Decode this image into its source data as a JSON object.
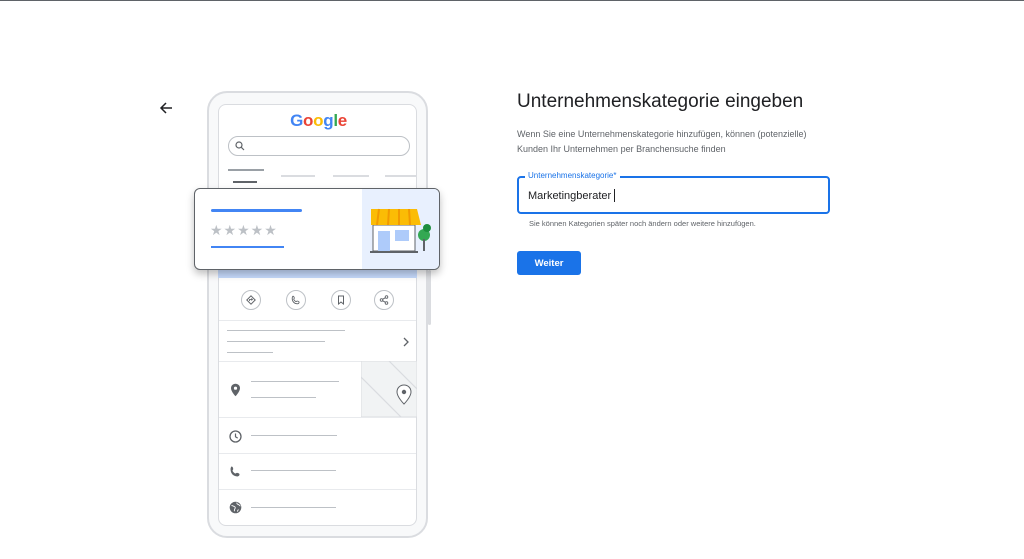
{
  "back_icon": "arrow-back-icon",
  "illustration": {
    "logo_letters": [
      {
        "ch": "G",
        "color": "#4285f4"
      },
      {
        "ch": "o",
        "color": "#ea4335"
      },
      {
        "ch": "o",
        "color": "#fbbc05"
      },
      {
        "ch": "g",
        "color": "#4285f4"
      },
      {
        "ch": "l",
        "color": "#34a853"
      },
      {
        "ch": "e",
        "color": "#ea4335"
      }
    ],
    "stars": "★★★★★",
    "action_icons": [
      "directions-icon",
      "phone-icon",
      "bookmark-icon",
      "share-icon"
    ],
    "row_icons": [
      "location-pin-icon",
      "clock-icon",
      "phone-icon",
      "globe-icon"
    ]
  },
  "form": {
    "title": "Unternehmenskategorie eingeben",
    "description": "Wenn Sie eine Unternehmenskategorie hinzufügen, können (potenzielle) Kunden Ihr Unternehmen per Branchensuche finden",
    "field_label": "Unternehmenskategorie*",
    "field_value": "Marketingberater",
    "hint": "Sie können Kategorien später noch ändern oder weitere hinzufügen.",
    "submit_label": "Weiter"
  },
  "colors": {
    "accent": "#1a73e8",
    "google_blue": "#4285f4"
  }
}
